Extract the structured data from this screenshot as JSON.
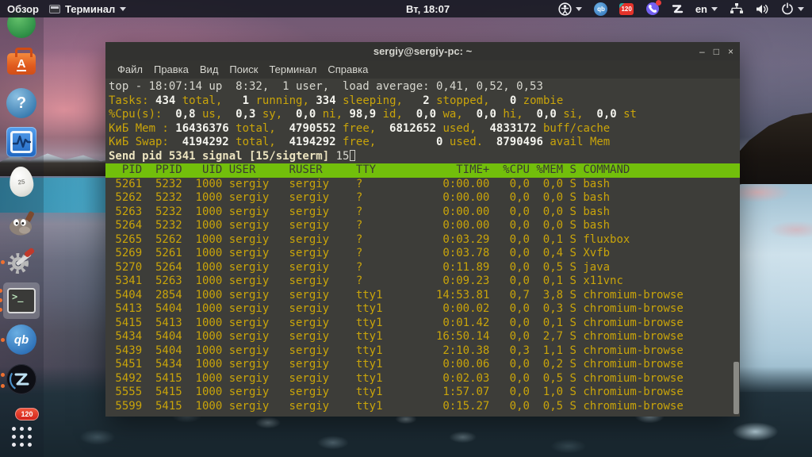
{
  "panel": {
    "overview": "Обзор",
    "app_menu": "Терминал",
    "clock": "Вт, 18:07",
    "language": "en",
    "tray_badge": "120"
  },
  "dock": {
    "software_letter": "A",
    "help_mark": "?",
    "egg_label": "25",
    "terminal_glyph": ">_",
    "qb_label": "qb",
    "badge_count": "120"
  },
  "window": {
    "title": "sergiy@sergiy-pc: ~",
    "buttons": {
      "minimize": "–",
      "maximize": "□",
      "close": "×"
    },
    "menu": [
      "Файл",
      "Правка",
      "Вид",
      "Поиск",
      "Терминал",
      "Справка"
    ]
  },
  "terminal": {
    "uptime_line": [
      [
        "top - 18:07:14 up  8:32,  1 user,  load average: 0,41, 0,52, 0,53",
        "n"
      ]
    ],
    "tasks_line": [
      [
        "Tasks: ",
        "y"
      ],
      [
        "434",
        "w"
      ],
      [
        " total,   ",
        "y"
      ],
      [
        "1",
        "w"
      ],
      [
        " running, ",
        "y"
      ],
      [
        "334",
        "w"
      ],
      [
        " sleeping,   ",
        "y"
      ],
      [
        "2",
        "w"
      ],
      [
        " stopped,   ",
        "y"
      ],
      [
        "0",
        "w"
      ],
      [
        " zombie",
        "y"
      ]
    ],
    "cpu_line": [
      [
        "%Cpu(s): ",
        "y"
      ],
      [
        " 0,8",
        "w"
      ],
      [
        " us, ",
        "y"
      ],
      [
        " 0,3",
        "w"
      ],
      [
        " sy, ",
        "y"
      ],
      [
        " 0,0",
        "w"
      ],
      [
        " ni,",
        "y"
      ],
      [
        " 98,9",
        "w"
      ],
      [
        " id, ",
        "y"
      ],
      [
        " 0,0",
        "w"
      ],
      [
        " wa, ",
        "y"
      ],
      [
        " 0,0",
        "w"
      ],
      [
        " hi, ",
        "y"
      ],
      [
        " 0,0",
        "w"
      ],
      [
        " si, ",
        "y"
      ],
      [
        " 0,0",
        "w"
      ],
      [
        " st",
        "y"
      ]
    ],
    "mem_line": [
      [
        "КиБ Mem : ",
        "y"
      ],
      [
        "16436376",
        "w"
      ],
      [
        " total, ",
        "y"
      ],
      [
        " 4790552",
        "w"
      ],
      [
        " free, ",
        "y"
      ],
      [
        " 6812652",
        "w"
      ],
      [
        " used, ",
        "y"
      ],
      [
        " 4833172",
        "w"
      ],
      [
        " buff/cache",
        "y"
      ]
    ],
    "swap_line": [
      [
        "КиБ Swap: ",
        "y"
      ],
      [
        " 4194292",
        "w"
      ],
      [
        " total, ",
        "y"
      ],
      [
        " 4194292",
        "w"
      ],
      [
        " free, ",
        "y"
      ],
      [
        "        0",
        "w"
      ],
      [
        " used. ",
        "y"
      ],
      [
        " 8790496",
        "w"
      ],
      [
        " avail Mem",
        "y"
      ]
    ],
    "prompt_line": [
      [
        "Send pid 5341 signal [15/sigterm] ",
        "p"
      ],
      [
        "15",
        "n"
      ],
      [
        "",
        "cursor"
      ]
    ],
    "table": {
      "headers": [
        "PID",
        "PPID",
        "UID",
        "USER",
        "RUSER",
        "TTY",
        "TIME+",
        "%CPU",
        "%MEM",
        "S",
        "COMMAND"
      ],
      "rows": [
        [
          "5261",
          "5232",
          "1000",
          "sergiy",
          "sergiy",
          "?",
          "0:00.00",
          "0,0",
          "0,0",
          "S",
          "bash"
        ],
        [
          "5262",
          "5232",
          "1000",
          "sergiy",
          "sergiy",
          "?",
          "0:00.00",
          "0,0",
          "0,0",
          "S",
          "bash"
        ],
        [
          "5263",
          "5232",
          "1000",
          "sergiy",
          "sergiy",
          "?",
          "0:00.00",
          "0,0",
          "0,0",
          "S",
          "bash"
        ],
        [
          "5264",
          "5232",
          "1000",
          "sergiy",
          "sergiy",
          "?",
          "0:00.00",
          "0,0",
          "0,0",
          "S",
          "bash"
        ],
        [
          "5265",
          "5262",
          "1000",
          "sergiy",
          "sergiy",
          "?",
          "0:03.29",
          "0,0",
          "0,1",
          "S",
          "fluxbox"
        ],
        [
          "5269",
          "5261",
          "1000",
          "sergiy",
          "sergiy",
          "?",
          "0:03.78",
          "0,0",
          "0,4",
          "S",
          "Xvfb"
        ],
        [
          "5270",
          "5264",
          "1000",
          "sergiy",
          "sergiy",
          "?",
          "0:11.89",
          "0,0",
          "0,5",
          "S",
          "java"
        ],
        [
          "5341",
          "5263",
          "1000",
          "sergiy",
          "sergiy",
          "?",
          "0:09.23",
          "0,0",
          "0,1",
          "S",
          "x11vnc"
        ],
        [
          "5404",
          "2854",
          "1000",
          "sergiy",
          "sergiy",
          "tty1",
          "14:53.81",
          "0,7",
          "3,8",
          "S",
          "chromium-browse"
        ],
        [
          "5413",
          "5404",
          "1000",
          "sergiy",
          "sergiy",
          "tty1",
          "0:00.02",
          "0,0",
          "0,3",
          "S",
          "chromium-browse"
        ],
        [
          "5415",
          "5413",
          "1000",
          "sergiy",
          "sergiy",
          "tty1",
          "0:01.42",
          "0,0",
          "0,1",
          "S",
          "chromium-browse"
        ],
        [
          "5434",
          "5404",
          "1000",
          "sergiy",
          "sergiy",
          "tty1",
          "16:50.14",
          "0,0",
          "2,7",
          "S",
          "chromium-browse"
        ],
        [
          "5439",
          "5404",
          "1000",
          "sergiy",
          "sergiy",
          "tty1",
          "2:10.38",
          "0,3",
          "1,1",
          "S",
          "chromium-browse"
        ],
        [
          "5451",
          "5434",
          "1000",
          "sergiy",
          "sergiy",
          "tty1",
          "0:00.06",
          "0,0",
          "0,2",
          "S",
          "chromium-browse"
        ],
        [
          "5492",
          "5415",
          "1000",
          "sergiy",
          "sergiy",
          "tty1",
          "0:02.03",
          "0,0",
          "0,5",
          "S",
          "chromium-browse"
        ],
        [
          "5555",
          "5415",
          "1000",
          "sergiy",
          "sergiy",
          "tty1",
          "1:57.07",
          "0,0",
          "1,0",
          "S",
          "chromium-browse"
        ],
        [
          "5599",
          "5415",
          "1000",
          "sergiy",
          "sergiy",
          "tty1",
          "0:15.27",
          "0,0",
          "0,5",
          "S",
          "chromium-browse"
        ]
      ]
    }
  },
  "colors": {
    "header_green": "#72bf0b",
    "text_yellow": "#c9a40a",
    "bold_white": "#f4f4ee",
    "terminal_bg": "#3d3d39",
    "ubuntu_orange": "#ef7030"
  }
}
